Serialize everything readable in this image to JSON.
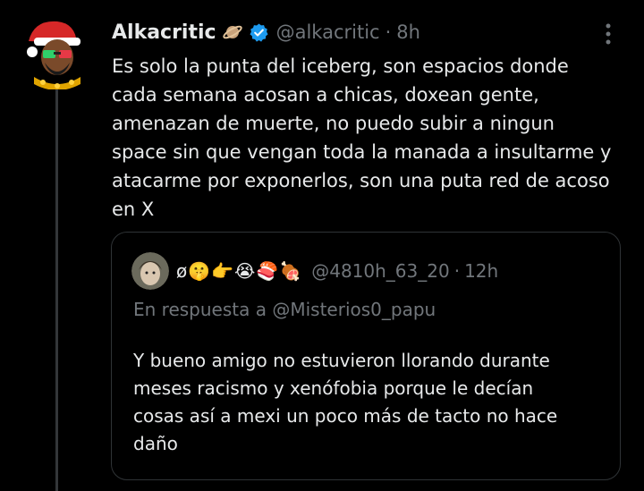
{
  "tweet": {
    "author_name": "Alkacritic",
    "author_handle": "@alkacritic",
    "separator": "·",
    "time": "8h",
    "badge_icons": [
      "ringed-planet-icon",
      "verified-badge-icon"
    ],
    "more_icon": "vertical-ellipsis-icon",
    "text": "Es solo la punta del iceberg, son espacios donde\ncada semana acosan a chicas, doxean gente,\namenazan de muerte, no puedo subir a ningun\nspace sin que vengan toda la manada a insultarme y\natacarme por exponerlos, son una puta red de acoso\nen X"
  },
  "quoted_tweet": {
    "author_name": "ø🤫👉😭🍣🍖",
    "author_handle": "@4810h_63_20",
    "separator": "·",
    "time": "12h",
    "reply_context": "En respuesta a @Misterios0_papu",
    "text": "Y bueno amigo no estuvieron llorando durante\nmeses racismo y xenófobia porque le decían\ncosas así a mexi un poco más de tacto no hace\ndaño"
  },
  "colors": {
    "background": "#000000",
    "text_primary": "#e7e9ea",
    "text_secondary": "#71767b",
    "border": "#2f3336",
    "verified_blue": "#1d9bf0"
  }
}
